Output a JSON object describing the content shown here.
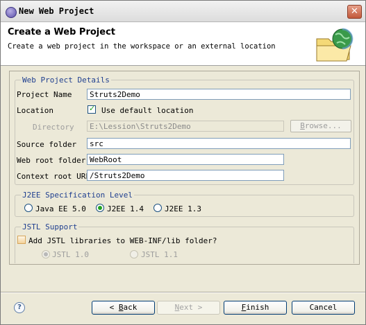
{
  "window": {
    "title": "New Web Project",
    "close_label": "✕"
  },
  "banner": {
    "title": "Create a Web Project",
    "description": "Create a web project in the workspace or an external location"
  },
  "details": {
    "legend": "Web Project Details",
    "project_name_label": "Project Name",
    "project_name_value": "Struts2Demo",
    "location_label": "Location",
    "use_default_label": "Use default location",
    "use_default_checked": true,
    "directory_label": "Directory",
    "directory_value": "E:\\Lession\\Struts2Demo",
    "browse_label": "Browse...",
    "source_folder_label": "Source folder",
    "source_folder_value": "src",
    "web_root_label": "Web root folder",
    "web_root_value": "WebRoot",
    "context_root_label": "Context root URL",
    "context_root_value": "/Struts2Demo"
  },
  "j2ee": {
    "legend": "J2EE Specification Level",
    "options": [
      {
        "label": "Java EE 5.0",
        "selected": false
      },
      {
        "label": "J2EE 1.4",
        "selected": true
      },
      {
        "label": "J2EE 1.3",
        "selected": false
      }
    ]
  },
  "jstl": {
    "legend": "JSTL Support",
    "add_label": "Add JSTL libraries to WEB-INF/lib folder?",
    "add_checked": false,
    "versions": [
      {
        "label": "JSTL 1.0",
        "selected": true
      },
      {
        "label": "JSTL 1.1",
        "selected": false
      }
    ]
  },
  "footer": {
    "help_label": "?",
    "back_label": "< Back",
    "next_label": "Next >",
    "finish_label": "Finish",
    "cancel_label": "Cancel"
  }
}
